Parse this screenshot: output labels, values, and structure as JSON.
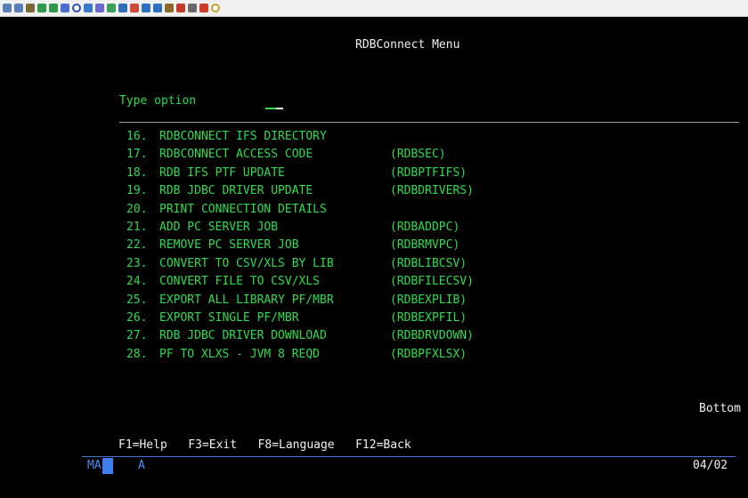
{
  "toolbar": {
    "icons": [
      "copy",
      "paste",
      "paste-special",
      "upload",
      "download",
      "save",
      "record",
      "screen",
      "print",
      "send",
      "receive",
      "keyboard",
      "hotspots",
      "macro",
      "tools",
      "run",
      "stop",
      "play",
      "help"
    ]
  },
  "screen": {
    "title": "RDBConnect Menu",
    "type_option_label": "Type option",
    "menu": [
      {
        "num": "16.",
        "desc": "RDBCONNECT IFS DIRECTORY",
        "cmd": ""
      },
      {
        "num": "17.",
        "desc": "RDBCONNECT ACCESS CODE",
        "cmd": "(RDBSEC)"
      },
      {
        "num": "18.",
        "desc": "RDB IFS PTF UPDATE",
        "cmd": "(RDBPTFIFS)"
      },
      {
        "num": "19.",
        "desc": "RDB JDBC DRIVER UPDATE",
        "cmd": "(RDBDRIVERS)"
      },
      {
        "num": "20.",
        "desc": "PRINT CONNECTION DETAILS",
        "cmd": ""
      },
      {
        "num": "21.",
        "desc": "ADD PC SERVER JOB",
        "cmd": "(RDBADDPC)"
      },
      {
        "num": "22.",
        "desc": "REMOVE PC SERVER JOB",
        "cmd": "(RDBRMVPC)"
      },
      {
        "num": "23.",
        "desc": "CONVERT TO CSV/XLS BY LIB",
        "cmd": "(RDBLIBCSV)"
      },
      {
        "num": "24.",
        "desc": "CONVERT FILE TO CSV/XLS",
        "cmd": "(RDBFILECSV)"
      },
      {
        "num": "25.",
        "desc": "EXPORT ALL LIBRARY PF/MBR",
        "cmd": "(RDBEXPLIB)"
      },
      {
        "num": "26.",
        "desc": "EXPORT SINGLE PF/MBR",
        "cmd": "(RDBEXPFIL)"
      },
      {
        "num": "27.",
        "desc": "RDB JDBC DRIVER DOWNLOAD",
        "cmd": "(RDBDRVDOWN)"
      },
      {
        "num": "28.",
        "desc": "PF TO XLXS - JVM 8 REQD",
        "cmd": "(RDBPFXLSX)"
      }
    ],
    "more_indicator": "Bottom",
    "function_keys": "F1=Help   F3=Exit   F8=Language   F12=Back"
  },
  "status_bar": {
    "mode": "MA",
    "indicator": "A",
    "position": "04/02"
  },
  "colors": {
    "background": "#000000",
    "text_green": "#2fdb4e",
    "text_white": "#f0f0f0",
    "status_blue": "#4f8cf5"
  }
}
